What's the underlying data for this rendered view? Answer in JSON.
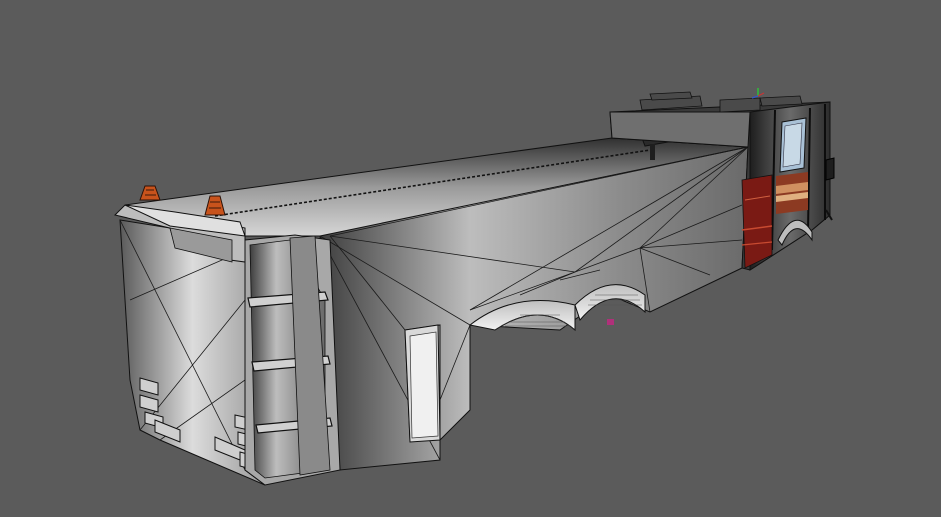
{
  "viewport": {
    "background": "#5b5b5b",
    "model": "fire-truck-wireframe",
    "colors": {
      "body_light": "#e6e6e6",
      "body_mid": "#a9a9a9",
      "body_dark": "#4a4a4a",
      "edge": "#111111",
      "trim_red": "#8c1f17",
      "beacon": "#c8531c",
      "marker": "#b0307a",
      "axis_green": "#2fbf3a"
    }
  }
}
